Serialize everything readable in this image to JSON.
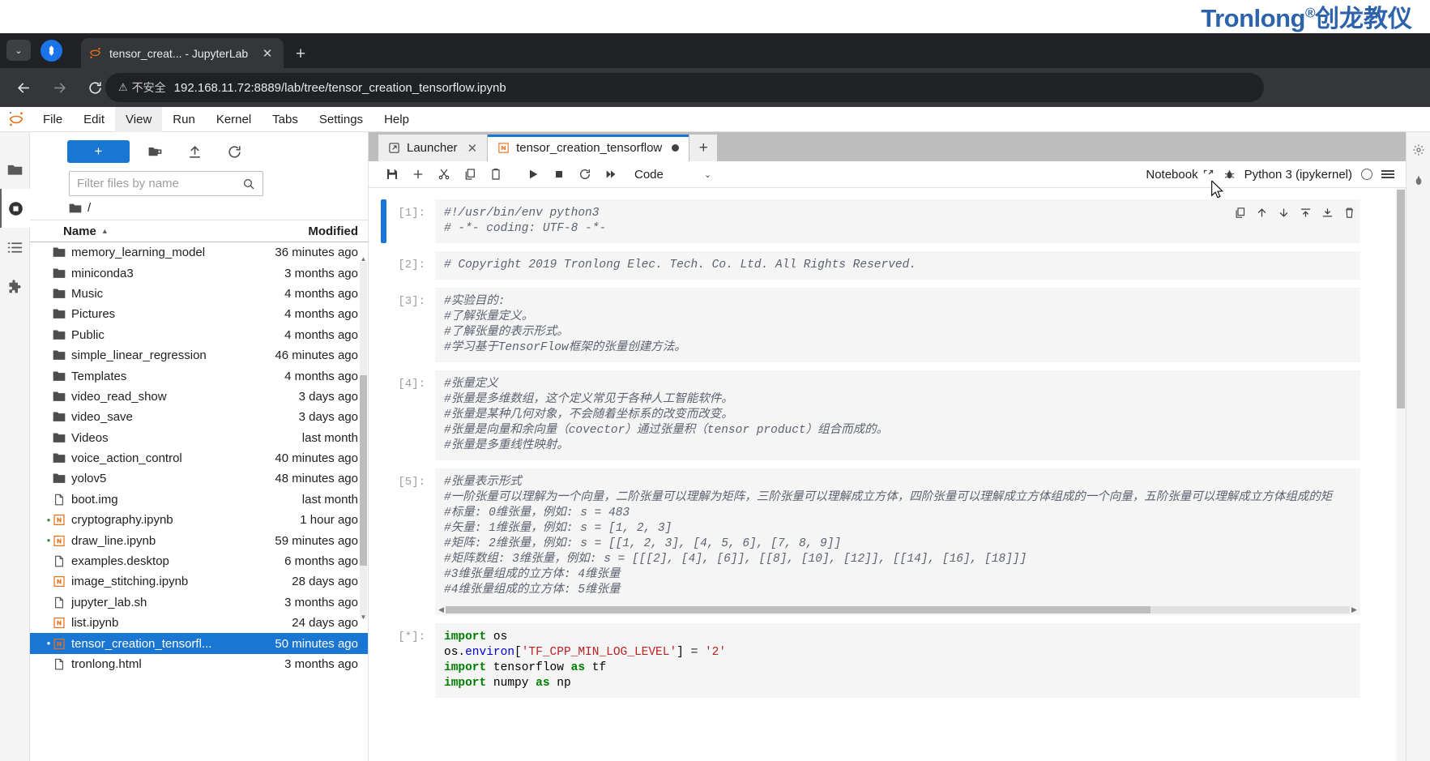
{
  "brand": {
    "logo_text": "Tronlong",
    "logo_reg": "®",
    "logo_cn": "创龙教仪",
    "logo_color": "#2d63ab"
  },
  "browser": {
    "tab": {
      "title": "tensor_creat... - JupyterLab",
      "favicon": "jupyter-icon",
      "close_label": "✕"
    },
    "new_tab_label": "+",
    "chevron_label": "⌄",
    "window_controls": {
      "minimize": "minimize-icon",
      "maximize": "restore-icon",
      "close": "close-icon"
    },
    "nav": {
      "back": "back-arrow-icon",
      "forward": "forward-arrow-icon",
      "reload": "reload-icon"
    },
    "security": {
      "warning_glyph": "⚠",
      "label": "不安全"
    },
    "url": "192.168.11.72:8889/lab/tree/tensor_creation_tensorflow.ipynb",
    "omni_icons": [
      "password-key-icon",
      "translate-icon",
      "bookmark-star-icon"
    ],
    "profile": "profile-avatar-icon",
    "menu": "kebab-menu-icon"
  },
  "jupyter": {
    "menus": [
      "File",
      "Edit",
      "View",
      "Run",
      "Kernel",
      "Tabs",
      "Settings",
      "Help"
    ],
    "active_menu": "View",
    "activity_bar": [
      {
        "name": "file-browser",
        "icon": "folder-icon",
        "active": true
      },
      {
        "name": "running-terminals",
        "icon": "stop-circle-icon",
        "active": false
      },
      {
        "name": "table-of-contents",
        "icon": "list-icon",
        "active": false
      },
      {
        "name": "extension-manager",
        "icon": "puzzle-icon",
        "active": false
      }
    ],
    "filebrowser": {
      "new_button": "+",
      "toolbar_icons": [
        "new-folder-icon",
        "upload-icon",
        "refresh-icon"
      ],
      "filter_placeholder": "Filter files by name",
      "filter_value": "",
      "breadcrumb_root": "/",
      "columns": {
        "name": "Name",
        "modified": "Modified"
      },
      "sort_caret": "▲",
      "rows": [
        {
          "name": "memory_learning_model",
          "modified": "36 minutes ago",
          "type": "folder",
          "running": false,
          "selected": false
        },
        {
          "name": "miniconda3",
          "modified": "3 months ago",
          "type": "folder",
          "running": false,
          "selected": false
        },
        {
          "name": "Music",
          "modified": "4 months ago",
          "type": "folder",
          "running": false,
          "selected": false
        },
        {
          "name": "Pictures",
          "modified": "4 months ago",
          "type": "folder",
          "running": false,
          "selected": false
        },
        {
          "name": "Public",
          "modified": "4 months ago",
          "type": "folder",
          "running": false,
          "selected": false
        },
        {
          "name": "simple_linear_regression",
          "modified": "46 minutes ago",
          "type": "folder",
          "running": false,
          "selected": false
        },
        {
          "name": "Templates",
          "modified": "4 months ago",
          "type": "folder",
          "running": false,
          "selected": false
        },
        {
          "name": "video_read_show",
          "modified": "3 days ago",
          "type": "folder",
          "running": false,
          "selected": false
        },
        {
          "name": "video_save",
          "modified": "3 days ago",
          "type": "folder",
          "running": false,
          "selected": false
        },
        {
          "name": "Videos",
          "modified": "last month",
          "type": "folder",
          "running": false,
          "selected": false
        },
        {
          "name": "voice_action_control",
          "modified": "40 minutes ago",
          "type": "folder",
          "running": false,
          "selected": false
        },
        {
          "name": "yolov5",
          "modified": "48 minutes ago",
          "type": "folder",
          "running": false,
          "selected": false
        },
        {
          "name": "boot.img",
          "modified": "last month",
          "type": "file",
          "running": false,
          "selected": false
        },
        {
          "name": "cryptography.ipynb",
          "modified": "1 hour ago",
          "type": "notebook",
          "running": true,
          "selected": false
        },
        {
          "name": "draw_line.ipynb",
          "modified": "59 minutes ago",
          "type": "notebook",
          "running": true,
          "selected": false
        },
        {
          "name": "examples.desktop",
          "modified": "6 months ago",
          "type": "file",
          "running": false,
          "selected": false
        },
        {
          "name": "image_stitching.ipynb",
          "modified": "28 days ago",
          "type": "notebook",
          "running": false,
          "selected": false
        },
        {
          "name": "jupyter_lab.sh",
          "modified": "3 months ago",
          "type": "file",
          "running": false,
          "selected": false
        },
        {
          "name": "list.ipynb",
          "modified": "24 days ago",
          "type": "notebook",
          "running": false,
          "selected": false
        },
        {
          "name": "tensor_creation_tensorfl...",
          "modified": "50 minutes ago",
          "type": "notebook",
          "running": true,
          "selected": true
        },
        {
          "name": "tronlong.html",
          "modified": "3 months ago",
          "type": "html",
          "running": false,
          "selected": false
        }
      ]
    },
    "tabs": [
      {
        "label": "Launcher",
        "icon": "launcher-icon",
        "active": false,
        "closable": true,
        "close_label": "✕"
      },
      {
        "label": "tensor_creation_tensorflow",
        "icon": "notebook-icon",
        "active": true,
        "dirty": true
      }
    ],
    "tab_add_label": "+",
    "notebook_toolbar": {
      "buttons": [
        "save-icon",
        "insert-cell-icon",
        "cut-icon",
        "copy-icon",
        "paste-icon",
        "run-icon",
        "stop-icon",
        "restart-icon",
        "restart-run-all-icon"
      ],
      "cell_type": "Code",
      "cell_type_caret": "⌄",
      "right": {
        "mode_label": "Notebook",
        "mode_icon": "external-link-icon",
        "debugger_icon": "bug-icon",
        "kernel_label": "Python 3 (ipykernel)",
        "kernel_status_icon": "kernel-idle-circle-icon",
        "menu_icon": "hamburger-icon"
      }
    },
    "cell_toolbar_icons": [
      "duplicate-icon",
      "move-up-icon",
      "move-down-icon",
      "insert-above-icon",
      "insert-below-icon",
      "delete-icon"
    ],
    "cells": [
      {
        "prompt": "[1]:",
        "active": true,
        "lines": [
          "#!/usr/bin/env python3",
          "# -*- coding: UTF-8 -*-"
        ]
      },
      {
        "prompt": "[2]:",
        "active": false,
        "lines": [
          "# Copyright 2019 Tronlong Elec. Tech. Co. Ltd. All Rights Reserved."
        ]
      },
      {
        "prompt": "[3]:",
        "active": false,
        "lines": [
          "#实验目的:",
          "#了解张量定义。",
          "#了解张量的表示形式。",
          "#学习基于TensorFlow框架的张量创建方法。"
        ]
      },
      {
        "prompt": "[4]:",
        "active": false,
        "lines": [
          "#张量定义",
          "#张量是多维数组，这个定义常见于各种人工智能软件。",
          "#张量是某种几何对象，不会随着坐标系的改变而改变。",
          "#张量是向量和余向量（covector）通过张量积（tensor product）组合而成的。",
          "#张量是多重线性映射。"
        ]
      },
      {
        "prompt": "[5]:",
        "active": false,
        "has_hscroll": true,
        "lines": [
          "#张量表示形式",
          "#一阶张量可以理解为一个向量，二阶张量可以理解为矩阵，三阶张量可以理解成立方体，四阶张量可以理解成立方体组成的一个向量，五阶张量可以理解成立方体组成的矩",
          "#标量: 0维张量，例如: s = 483",
          "#矢量: 1维张量，例如: s = [1, 2, 3]",
          "#矩阵: 2维张量，例如: s = [[1, 2, 3], [4, 5, 6], [7, 8, 9]]",
          "#矩阵数组: 3维张量，例如: s = [[[2], [4], [6]], [[8], [10], [12]], [[14], [16], [18]]]",
          "#3维张量组成的立方体: 4维张量",
          "#4维张量组成的立方体: 5维张量"
        ]
      },
      {
        "prompt": "[*]:",
        "active": false,
        "code": true,
        "lines": [
          "import os",
          "os.environ['TF_CPP_MIN_LOG_LEVEL'] = '2'",
          "import tensorflow as tf",
          "import numpy as np"
        ]
      }
    ]
  }
}
